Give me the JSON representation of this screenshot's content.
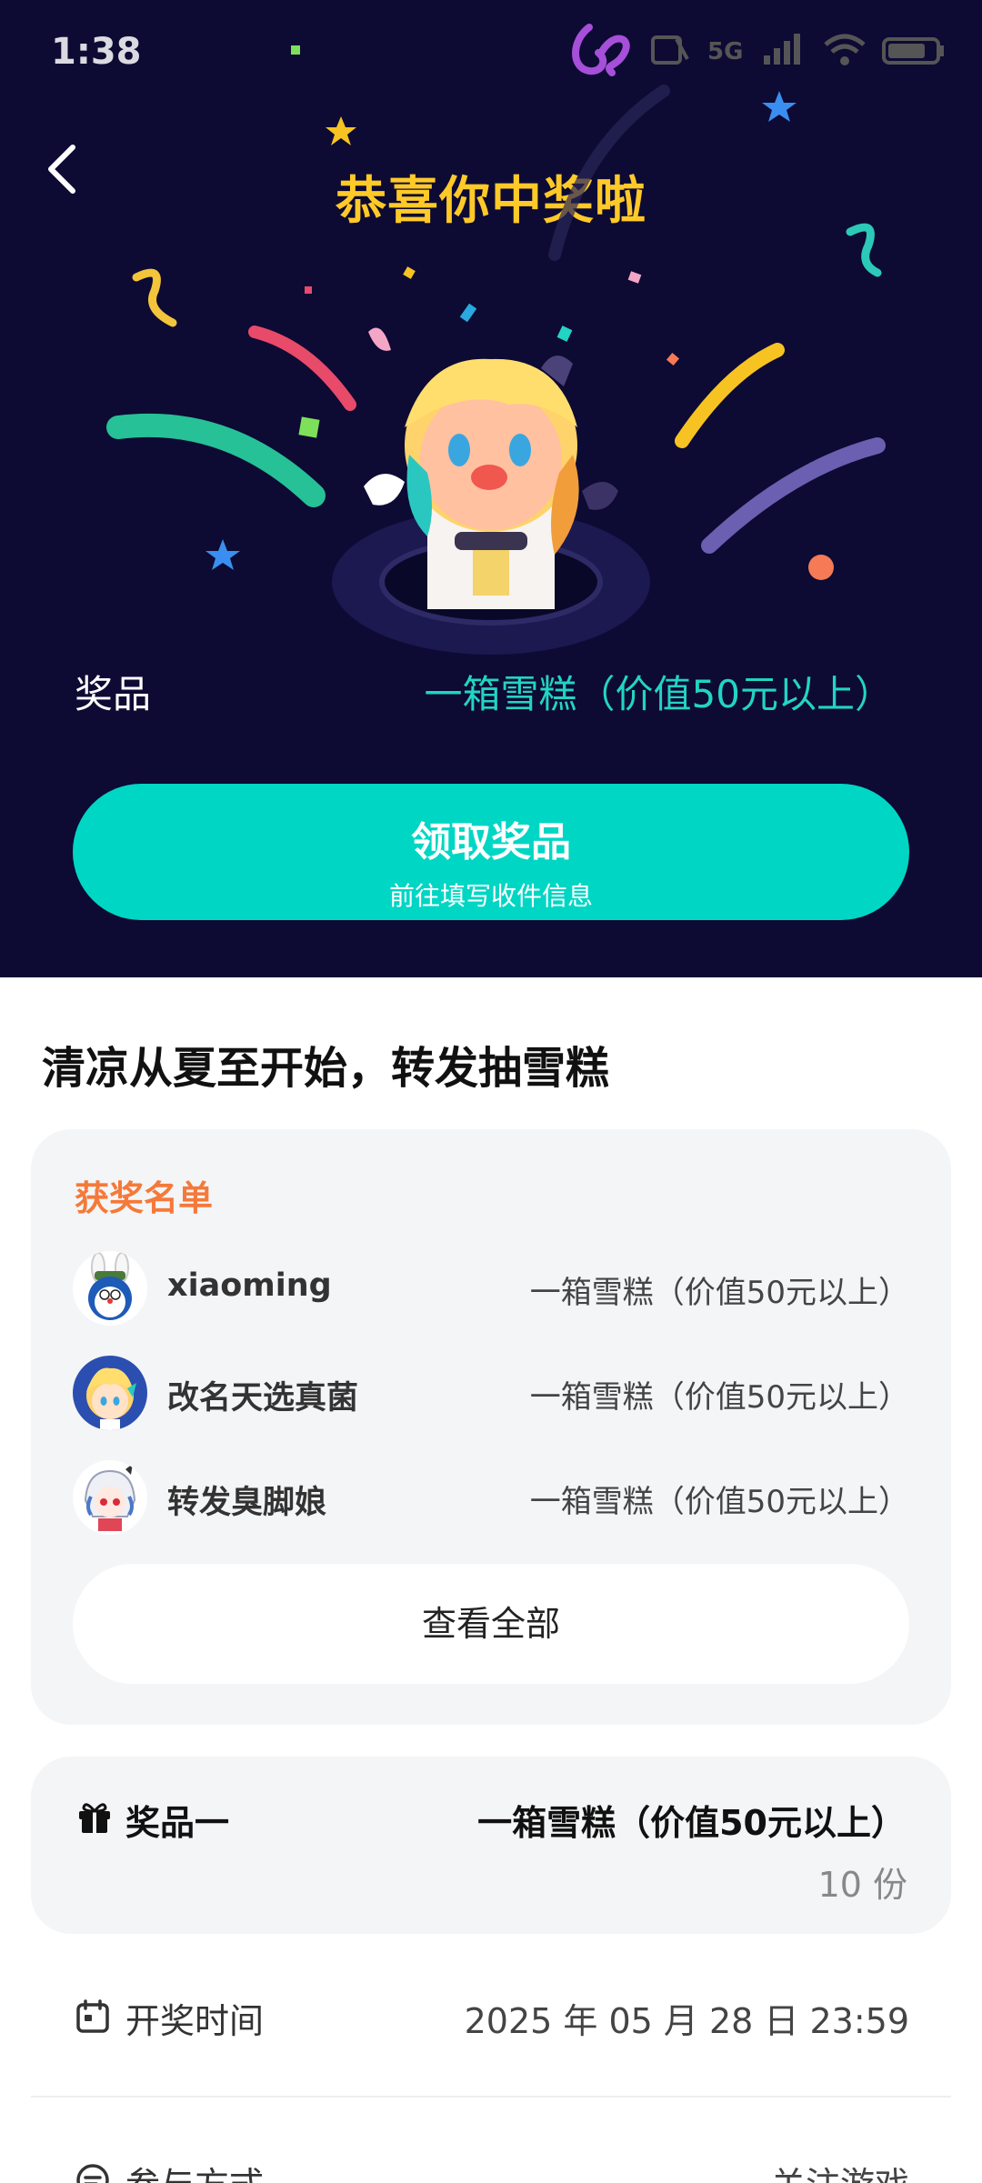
{
  "status_bar": {
    "time": "1:38"
  },
  "header": {
    "title": "恭喜你中奖啦"
  },
  "prize": {
    "label": "奖品",
    "value": "一箱雪糕（价值50元以上）"
  },
  "claim_button": {
    "label": "领取奖品",
    "sublabel": "前往填写收件信息"
  },
  "campaign": {
    "title": "清凉从夏至开始，转发抽雪糕"
  },
  "winners": {
    "heading": "获奖名单",
    "items": [
      {
        "name": "xiaoming",
        "prize": "一箱雪糕（价值50元以上）"
      },
      {
        "name": "改名天选真菌",
        "prize": "一箱雪糕（价值50元以上）"
      },
      {
        "name": "转发臭脚娘",
        "prize": "一箱雪糕（价值50元以上）"
      }
    ],
    "view_all_label": "查看全部"
  },
  "prize_tier": {
    "label": "奖品一",
    "value": "一箱雪糕（价值50元以上）",
    "quantity": "10 份"
  },
  "draw_time": {
    "label": "开奖时间",
    "value": "2025 年 05 月 28 日 23:59"
  },
  "participation": {
    "label": "参与方式",
    "value": "关注游戏"
  },
  "colors": {
    "hero_bg": "#0d0a34",
    "accent_teal": "#00d6c4",
    "title_gold": "#ffc928",
    "heading_orange": "#f5793a"
  }
}
